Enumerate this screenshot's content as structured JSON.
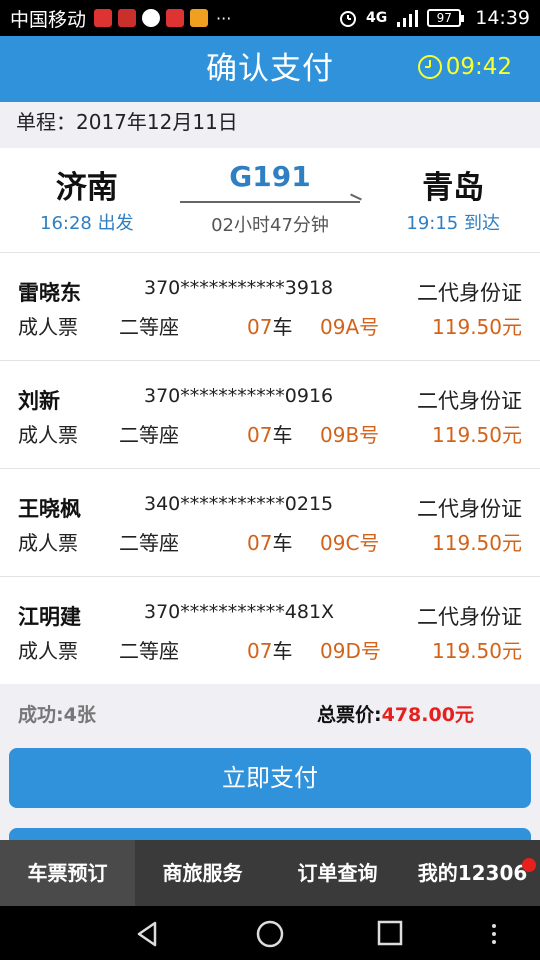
{
  "status_bar": {
    "carrier": "中国移动",
    "more": "···",
    "network": "4G",
    "battery": "97",
    "time": "14:39"
  },
  "header": {
    "title": "确认支付",
    "countdown": "09:42"
  },
  "trip": {
    "date_line": "单程：2017年12月11日",
    "from_station": "济南",
    "depart_time": "16:28 出发",
    "train_no": "G191",
    "duration": "02小时47分钟",
    "to_station": "青岛",
    "arrive_time": "19:15 到达"
  },
  "passengers": [
    {
      "name": "雷晓东",
      "id": "370***********3918",
      "id_type": "二代身份证",
      "ticket_type": "成人票",
      "seat_class": "二等座",
      "car_no": "07",
      "car_unit": "车",
      "seat": "09A号",
      "price": "119.50元"
    },
    {
      "name": "刘新",
      "id": "370***********0916",
      "id_type": "二代身份证",
      "ticket_type": "成人票",
      "seat_class": "二等座",
      "car_no": "07",
      "car_unit": "车",
      "seat": "09B号",
      "price": "119.50元"
    },
    {
      "name": "王晓枫",
      "id": "340***********0215",
      "id_type": "二代身份证",
      "ticket_type": "成人票",
      "seat_class": "二等座",
      "car_no": "07",
      "car_unit": "车",
      "seat": "09C号",
      "price": "119.50元"
    },
    {
      "name": "江明建",
      "id": "370***********481X",
      "id_type": "二代身份证",
      "ticket_type": "成人票",
      "seat_class": "二等座",
      "car_no": "07",
      "car_unit": "车",
      "seat": "09D号",
      "price": "119.50元"
    }
  ],
  "summary": {
    "success": "成功:4张",
    "total_label": "总票价:",
    "total_amount": "478.00元"
  },
  "actions": {
    "pay_now": "立即支付"
  },
  "tabs": [
    {
      "label": "车票预订",
      "active": true
    },
    {
      "label": "商旅服务",
      "active": false
    },
    {
      "label": "订单查询",
      "active": false
    },
    {
      "label": "我的12306",
      "active": false
    }
  ],
  "colors": {
    "accent": "#2f92db",
    "orange": "#d2631a",
    "red": "#e5201d",
    "timer": "#f8ff2e"
  }
}
